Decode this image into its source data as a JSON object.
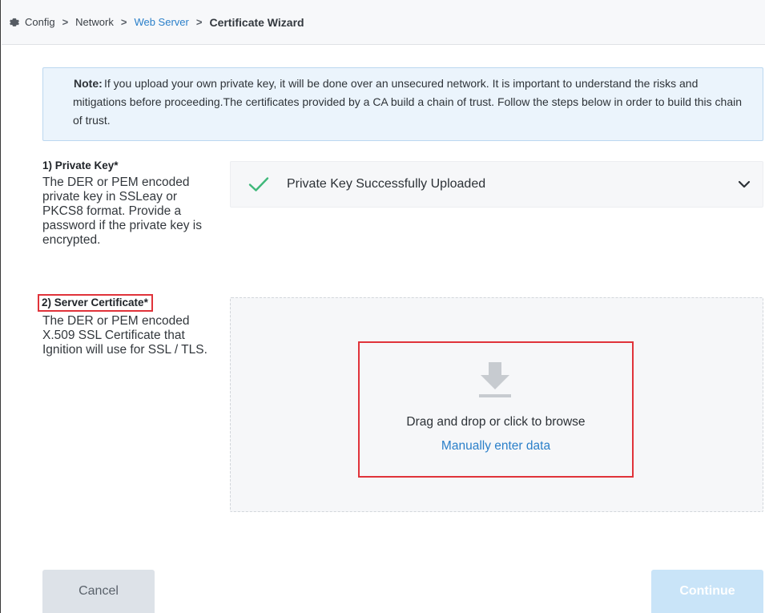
{
  "breadcrumb": {
    "items": [
      {
        "label": "Config"
      },
      {
        "label": "Network"
      },
      {
        "label": "Web Server"
      },
      {
        "label": "Certificate Wizard"
      }
    ],
    "separator": ">"
  },
  "note": {
    "label": "Note:",
    "text": "If you upload your own private key, it will be done over an unsecured network. It is important to understand the risks and mitigations before proceeding.The certificates provided by a CA build a chain of trust. Follow the steps below in order to build this chain of trust."
  },
  "steps": [
    {
      "title": "1) Private Key*",
      "description": "The DER or PEM encoded private key in SSLeay or PKCS8 format. Provide a password if the private key is encrypted.",
      "status_text": "Private Key Successfully Uploaded"
    },
    {
      "title": "2) Server Certificate*",
      "description": "The DER or PEM encoded X.509 SSL Certificate that Ignition will use for SSL / TLS.",
      "drop_text": "Drag and drop or click to browse",
      "manual_link": "Manually enter data"
    }
  ],
  "buttons": {
    "cancel": "Cancel",
    "continue": "Continue"
  },
  "colors": {
    "accent": "#2a7fc9",
    "success": "#3fb87a",
    "highlight": "#e0333a",
    "note_bg": "#ebf4fc"
  },
  "icons": {
    "breadcrumb": "gear-icon",
    "status": "checkmark-icon",
    "expand": "chevron-down-icon",
    "upload": "download-arrow-icon"
  }
}
